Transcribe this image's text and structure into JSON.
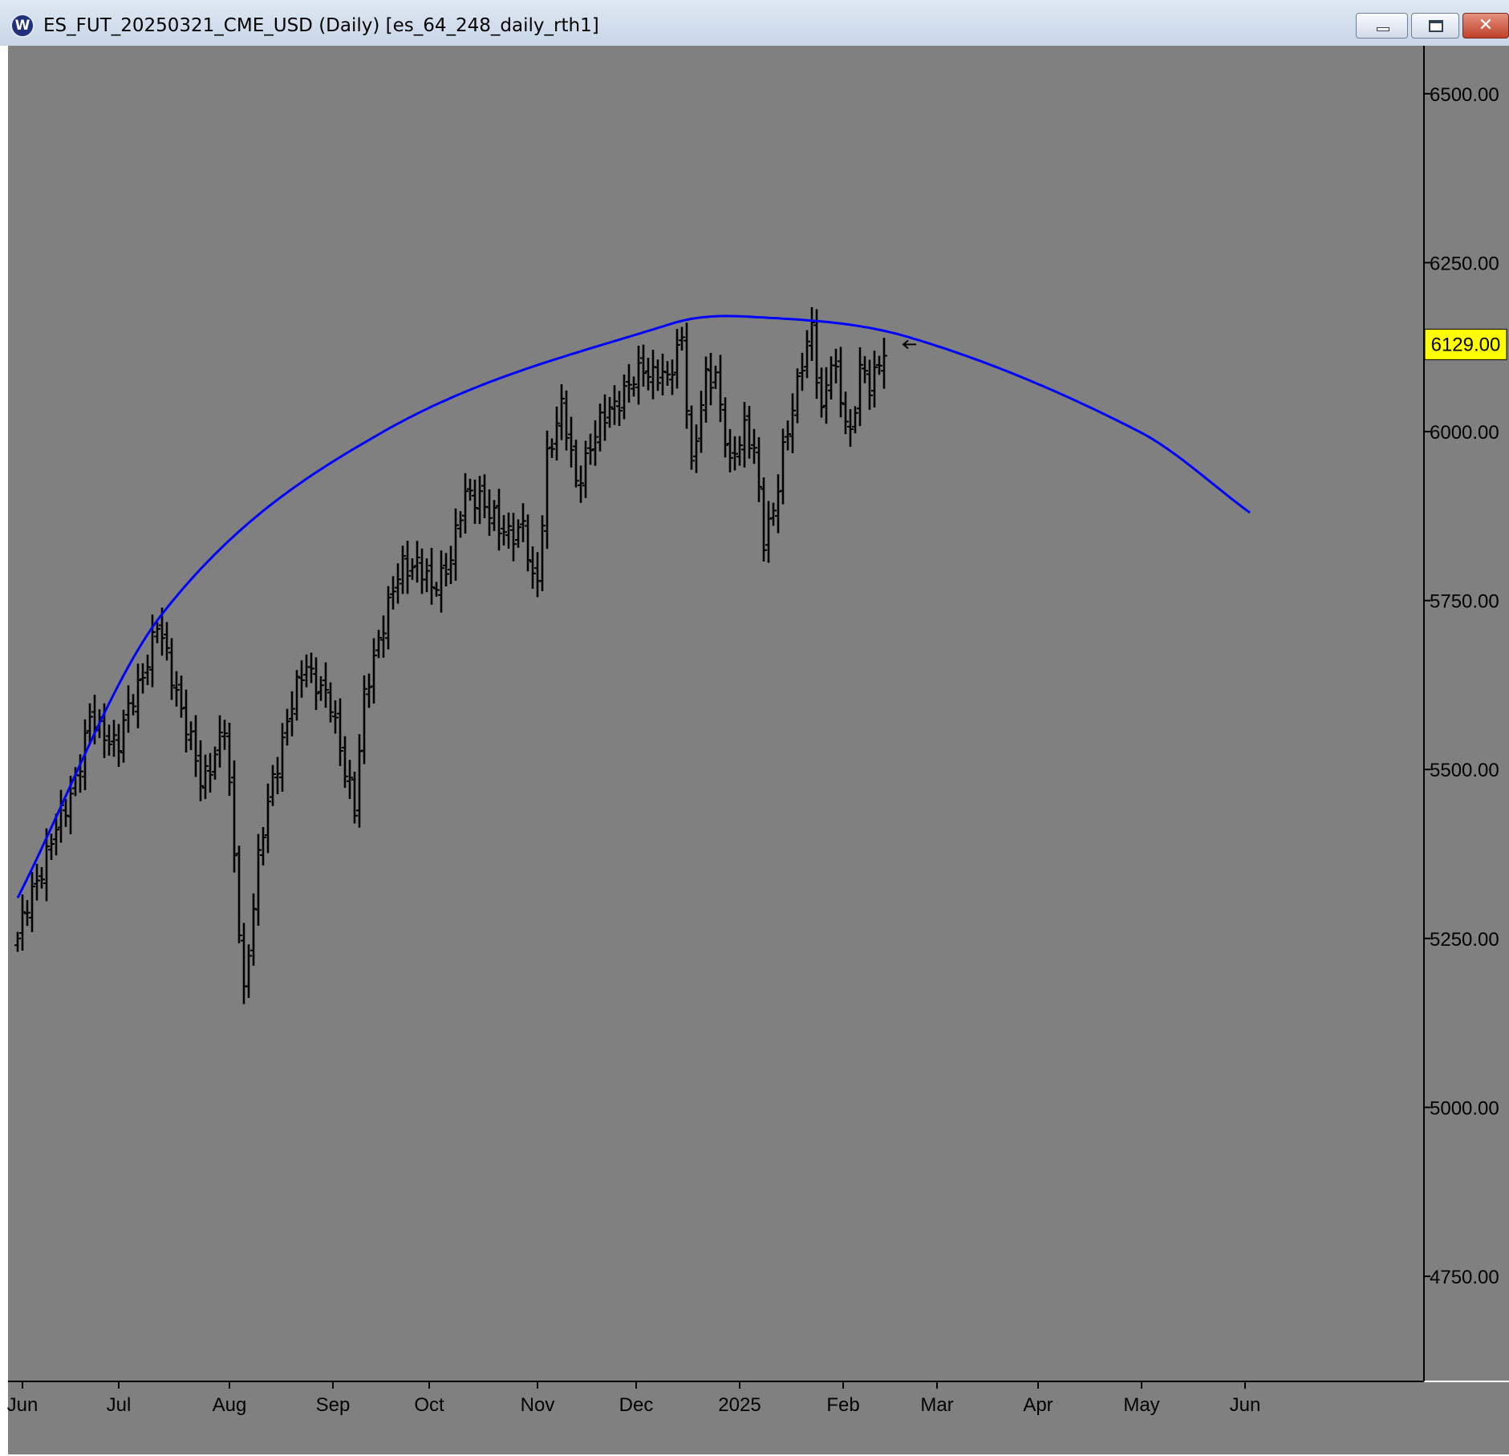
{
  "window": {
    "title": "ES_FUT_20250321_CME_USD (Daily) [es_64_248_daily_rth1]",
    "logo_letter": "W",
    "minimize_icon": "minimize-icon",
    "maximize_icon": "maximize-icon",
    "close_icon": "close-icon"
  },
  "colors": {
    "plot_background": "#808080",
    "bars": "#000000",
    "arc": "#0000ff",
    "price_label_bg": "#ffff00"
  },
  "chart_data": {
    "type": "ohlc-bar",
    "title": "",
    "xlabel": "",
    "ylabel": "",
    "x_unit": "trading days since first bar",
    "x_range": [
      -1,
      257
    ],
    "ylim": [
      4680,
      6680
    ],
    "y_ticks": [
      4750,
      5000,
      5250,
      5500,
      5750,
      6000,
      6250,
      6500
    ],
    "y_tick_labels": [
      "4750.00",
      "5000.00",
      "5250.00",
      "5500.00",
      "5750.00",
      "6000.00",
      "6250.00",
      "6500.00"
    ],
    "month_ticks": [
      {
        "label": "Jun",
        "x": 1
      },
      {
        "label": "Jul",
        "x": 21
      },
      {
        "label": "Aug",
        "x": 44
      },
      {
        "label": "Sep",
        "x": 65.5
      },
      {
        "label": "Oct",
        "x": 85.5
      },
      {
        "label": "Nov",
        "x": 108
      },
      {
        "label": "Dec",
        "x": 128.5
      },
      {
        "label": "2025",
        "x": 150
      },
      {
        "label": "Feb",
        "x": 171.5
      },
      {
        "label": "Mar",
        "x": 191
      },
      {
        "label": "Apr",
        "x": 212
      },
      {
        "label": "May",
        "x": 233.5
      },
      {
        "label": "Jun",
        "x": 255
      }
    ],
    "last_price": 6129.0,
    "last_price_label": "6129.00",
    "arc": {
      "description": "downward-opening parabolic cycle arc",
      "vertex_x": 152,
      "vertex_price": 6170,
      "points": [
        [
          0,
          5310
        ],
        [
          30,
          5730
        ],
        [
          76,
          6000
        ],
        [
          136,
          6160
        ],
        [
          152,
          6170
        ],
        [
          185,
          6140
        ],
        [
          233,
          6000
        ],
        [
          256,
          5880
        ]
      ]
    },
    "series": [
      {
        "name": "",
        "anchors": [
          [
            0,
            5250
          ],
          [
            6,
            5380
          ],
          [
            10,
            5440
          ],
          [
            15,
            5570
          ],
          [
            21,
            5540
          ],
          [
            29,
            5710
          ],
          [
            33,
            5620
          ],
          [
            38,
            5480
          ],
          [
            43,
            5560
          ],
          [
            47,
            5175
          ],
          [
            50,
            5360
          ],
          [
            53,
            5490
          ],
          [
            56,
            5570
          ],
          [
            60,
            5660
          ],
          [
            65,
            5590
          ],
          [
            69,
            5480
          ],
          [
            70,
            5440
          ],
          [
            72,
            5600
          ],
          [
            75,
            5700
          ],
          [
            80,
            5800
          ],
          [
            83,
            5810
          ],
          [
            86,
            5760
          ],
          [
            90,
            5820
          ],
          [
            93,
            5900
          ],
          [
            96,
            5910
          ],
          [
            100,
            5850
          ],
          [
            105,
            5860
          ],
          [
            107,
            5770
          ],
          [
            108,
            5780
          ],
          [
            110,
            5970
          ],
          [
            113,
            6030
          ],
          [
            116,
            5930
          ],
          [
            120,
            5990
          ],
          [
            123,
            6040
          ],
          [
            127,
            6060
          ],
          [
            130,
            6100
          ],
          [
            135,
            6070
          ],
          [
            138,
            6150
          ],
          [
            140,
            5940
          ],
          [
            143,
            6080
          ],
          [
            145,
            6090
          ],
          [
            148,
            5940
          ],
          [
            151,
            6010
          ],
          [
            153,
            5980
          ],
          [
            155,
            5830
          ],
          [
            157,
            5880
          ],
          [
            159,
            5980
          ],
          [
            162,
            6060
          ],
          [
            164,
            6130
          ],
          [
            165,
            6160
          ],
          [
            167,
            6030
          ],
          [
            169,
            6100
          ],
          [
            171,
            6050
          ],
          [
            173,
            6000
          ],
          [
            175,
            6090
          ],
          [
            177,
            6060
          ],
          [
            180,
            6130
          ]
        ]
      }
    ]
  }
}
